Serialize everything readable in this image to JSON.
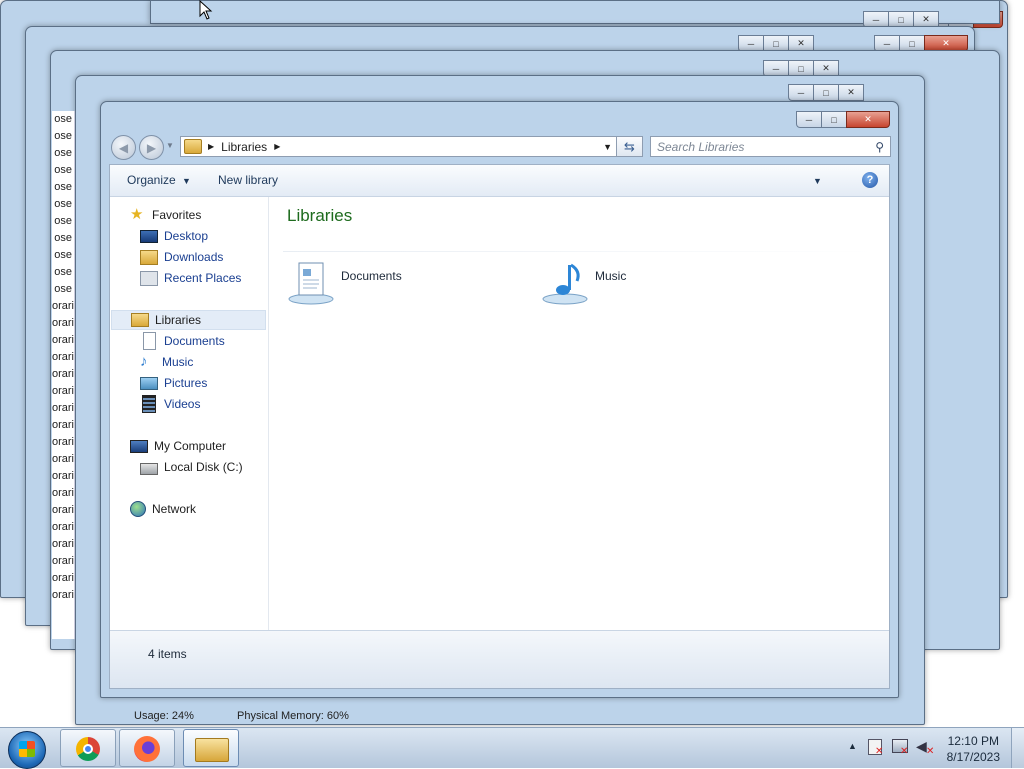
{
  "main_window": {
    "caption_buttons": {
      "minimize": "─",
      "maximize": "□",
      "close": "✕"
    },
    "address": {
      "segments": [
        "Libraries"
      ]
    },
    "search": {
      "placeholder": "Search Libraries"
    },
    "commands": {
      "organize": "Organize",
      "new_library": "New library"
    },
    "nav": {
      "favorites": {
        "label": "Favorites",
        "items": [
          "Desktop",
          "Downloads",
          "Recent Places"
        ]
      },
      "libraries": {
        "label": "Libraries",
        "items": [
          "Documents",
          "Music",
          "Pictures",
          "Videos"
        ]
      },
      "computer": {
        "label": "My Computer",
        "items": [
          "Local Disk (C:)"
        ]
      },
      "network": {
        "label": "Network"
      }
    },
    "content": {
      "title": "Libraries",
      "items": [
        {
          "label": "Documents",
          "icon": "documents-library-icon"
        },
        {
          "label": "Music",
          "icon": "music-library-icon"
        }
      ]
    },
    "status": "4 items"
  },
  "background_window": {
    "side_text": [
      "ose",
      "ose",
      "ose",
      "ose",
      "ose",
      "ose",
      "ose",
      "ose",
      "ose",
      "ose",
      "ose",
      "orari",
      "orari",
      "orari",
      "orari",
      "orari",
      "orari",
      "orari",
      "orari",
      "orari",
      "orari",
      "orari",
      "orari",
      "orari",
      "orari",
      "orari",
      "orari",
      "orari",
      "orari"
    ],
    "status_partial": [
      "Usage: 24%",
      "Physical Memory: 60%"
    ]
  },
  "taskbar": {
    "apps": [
      "chrome-icon",
      "firefox-icon",
      "explorer-icon"
    ],
    "tray_icons": [
      "show-hidden-icons-chevron-icon",
      "action-center-icon",
      "network-icon",
      "volume-muted-icon"
    ],
    "time": "12:10 PM",
    "date": "8/17/2023"
  },
  "colors": {
    "title_green": "#1e6b1e",
    "link_blue": "#1a3f91",
    "close_red": "#c7452f"
  }
}
